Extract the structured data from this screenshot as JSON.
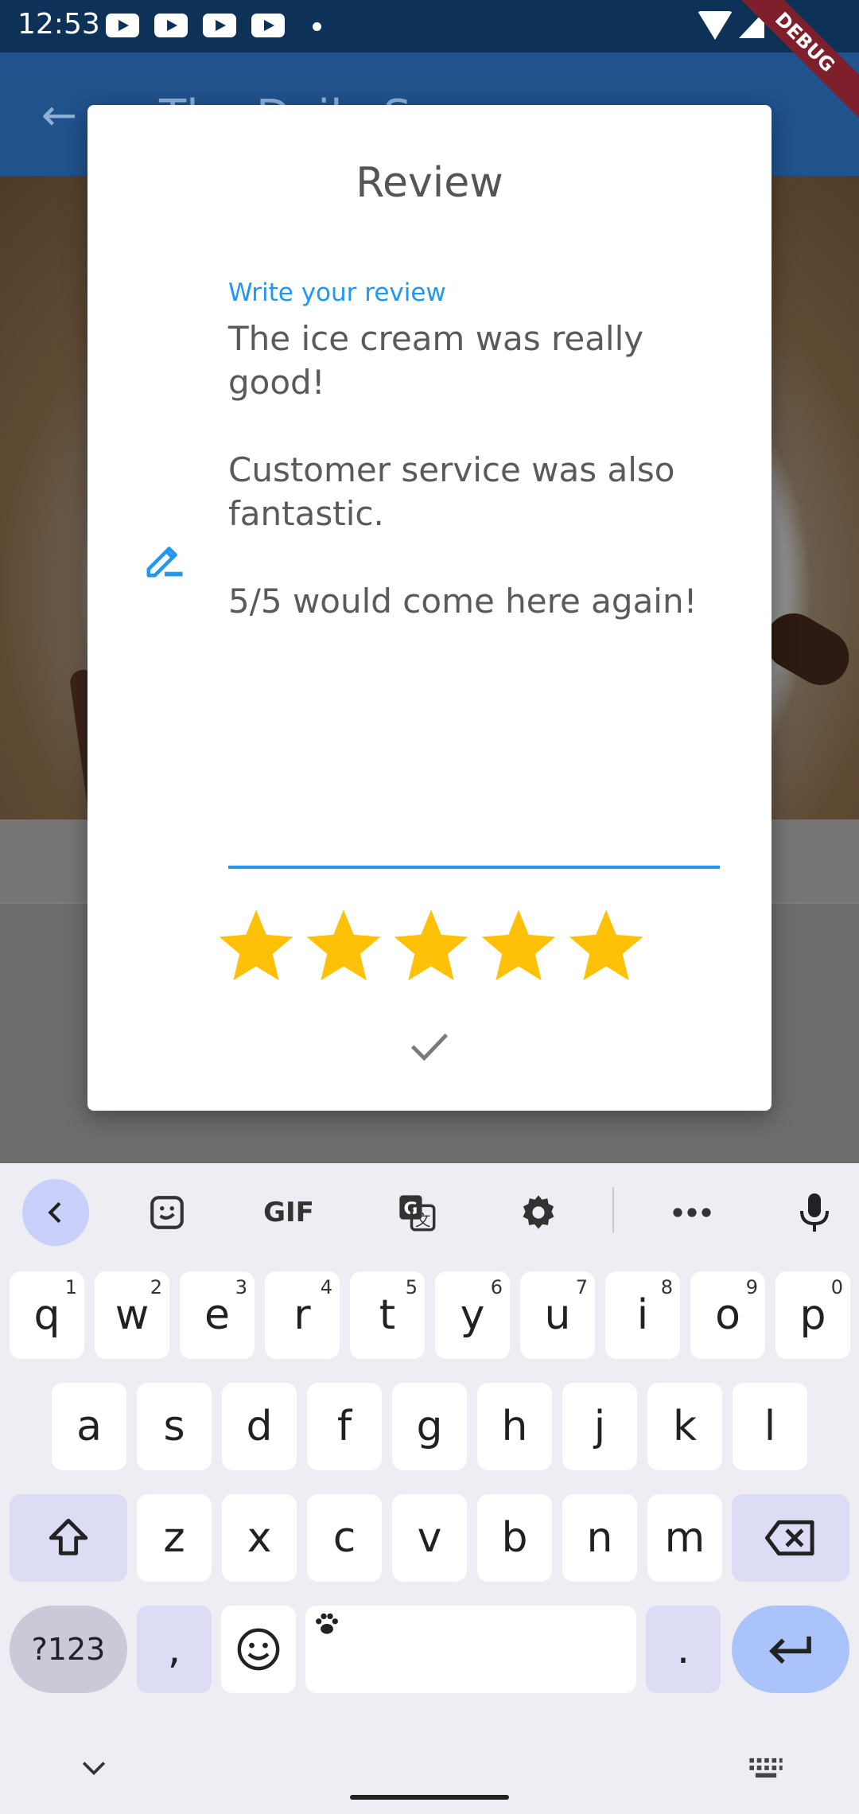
{
  "status_bar": {
    "time": "12:53",
    "debug_label": "DEBUG"
  },
  "background_app": {
    "title": "The Daily S",
    "back_icon": "arrow-back-icon"
  },
  "dialog": {
    "title": "Review",
    "field_label": "Write your review",
    "review_text": "The ice cream was really\ngood!\n\nCustomer service was also\nfantastic.\n\n5/5 would come here again!",
    "rating": 5,
    "rating_max": 5,
    "star_color": "#ffc107",
    "accent_color": "#2196f3",
    "edit_icon": "edit-pencil-icon",
    "confirm_icon": "check-icon"
  },
  "keyboard": {
    "toolbar": [
      "back-chevron-icon",
      "sticker-icon",
      "gif-icon",
      "translate-icon",
      "settings-icon",
      "more-icon",
      "mic-icon"
    ],
    "gif_label": "GIF",
    "row1": [
      {
        "k": "q",
        "s": "1"
      },
      {
        "k": "w",
        "s": "2"
      },
      {
        "k": "e",
        "s": "3"
      },
      {
        "k": "r",
        "s": "4"
      },
      {
        "k": "t",
        "s": "5"
      },
      {
        "k": "y",
        "s": "6"
      },
      {
        "k": "u",
        "s": "7"
      },
      {
        "k": "i",
        "s": "8"
      },
      {
        "k": "o",
        "s": "9"
      },
      {
        "k": "p",
        "s": "0"
      }
    ],
    "row2": [
      "a",
      "s",
      "d",
      "f",
      "g",
      "h",
      "j",
      "k",
      "l"
    ],
    "row3": [
      "z",
      "x",
      "c",
      "v",
      "b",
      "n",
      "m"
    ],
    "symbols_label": "?123",
    "comma": ",",
    "period": "."
  }
}
